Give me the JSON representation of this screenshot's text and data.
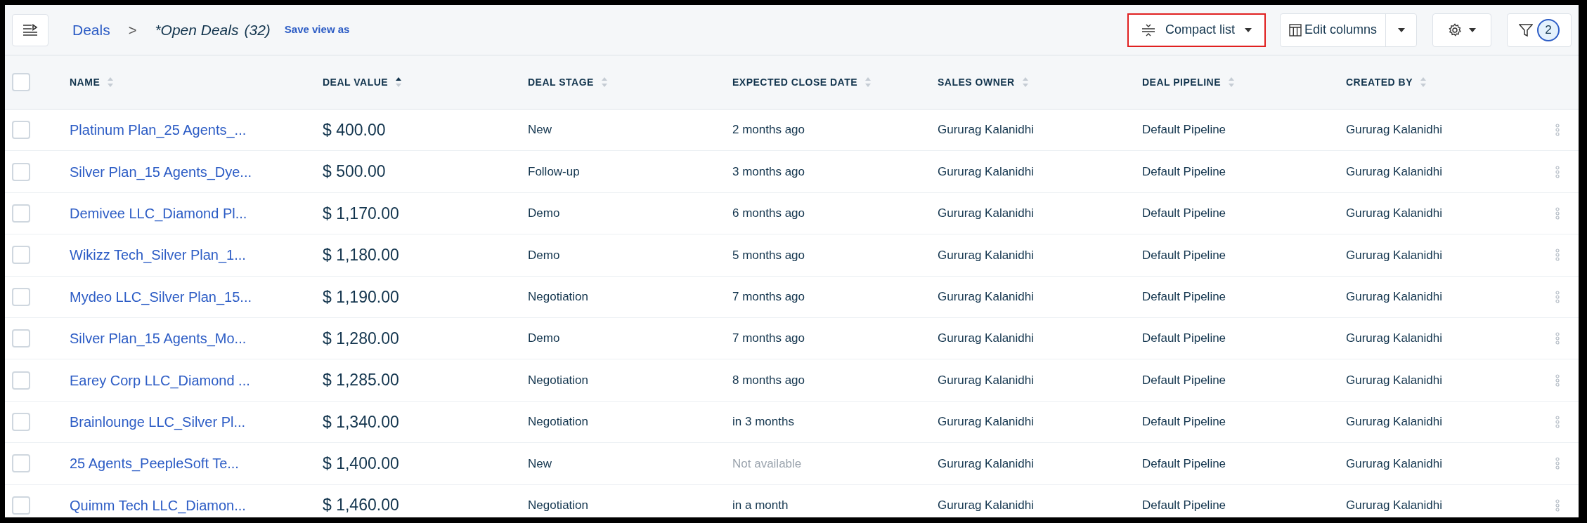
{
  "toolbar": {
    "breadcrumb": {
      "root": "Deals",
      "separator": ">",
      "current": "*Open Deals",
      "count": "(32)"
    },
    "save_view_link": "Save view as",
    "view_button": {
      "label": "Compact list",
      "highlighted": true
    },
    "edit_columns_button": "Edit columns",
    "filter_count": "2"
  },
  "table": {
    "columns": [
      {
        "label": "NAME",
        "sorted_ascending": false
      },
      {
        "label": "DEAL VALUE",
        "sorted_ascending": true
      },
      {
        "label": "DEAL STAGE",
        "sorted_ascending": false
      },
      {
        "label": "EXPECTED CLOSE DATE",
        "sorted_ascending": false
      },
      {
        "label": "SALES OWNER",
        "sorted_ascending": false
      },
      {
        "label": "DEAL PIPELINE",
        "sorted_ascending": false
      },
      {
        "label": "CREATED BY",
        "sorted_ascending": false
      }
    ],
    "select_all_checked": false,
    "rows": [
      {
        "checked": false,
        "name": "Platinum Plan_25 Agents_...",
        "value": "$ 400.00",
        "stage": "New",
        "close_date": "2 months ago",
        "close_date_muted": false,
        "owner": "Gururag Kalanidhi",
        "pipeline": "Default Pipeline",
        "created_by": "Gururag Kalanidhi"
      },
      {
        "checked": false,
        "name": "Silver Plan_15 Agents_Dye...",
        "value": "$ 500.00",
        "stage": "Follow-up",
        "close_date": "3 months ago",
        "close_date_muted": false,
        "owner": "Gururag Kalanidhi",
        "pipeline": "Default Pipeline",
        "created_by": "Gururag Kalanidhi"
      },
      {
        "checked": false,
        "name": "Demivee LLC_Diamond Pl...",
        "value": "$ 1,170.00",
        "stage": "Demo",
        "close_date": "6 months ago",
        "close_date_muted": false,
        "owner": "Gururag Kalanidhi",
        "pipeline": "Default Pipeline",
        "created_by": "Gururag Kalanidhi"
      },
      {
        "checked": false,
        "name": "Wikizz Tech_Silver Plan_1...",
        "value": "$ 1,180.00",
        "stage": "Demo",
        "close_date": "5 months ago",
        "close_date_muted": false,
        "owner": "Gururag Kalanidhi",
        "pipeline": "Default Pipeline",
        "created_by": "Gururag Kalanidhi"
      },
      {
        "checked": false,
        "name": "Mydeo LLC_Silver Plan_15...",
        "value": "$ 1,190.00",
        "stage": "Negotiation",
        "close_date": "7 months ago",
        "close_date_muted": false,
        "owner": "Gururag Kalanidhi",
        "pipeline": "Default Pipeline",
        "created_by": "Gururag Kalanidhi"
      },
      {
        "checked": false,
        "name": "Silver Plan_15 Agents_Mo...",
        "value": "$ 1,280.00",
        "stage": "Demo",
        "close_date": "7 months ago",
        "close_date_muted": false,
        "owner": "Gururag Kalanidhi",
        "pipeline": "Default Pipeline",
        "created_by": "Gururag Kalanidhi"
      },
      {
        "checked": false,
        "name": "Earey Corp LLC_Diamond ...",
        "value": "$ 1,285.00",
        "stage": "Negotiation",
        "close_date": "8 months ago",
        "close_date_muted": false,
        "owner": "Gururag Kalanidhi",
        "pipeline": "Default Pipeline",
        "created_by": "Gururag Kalanidhi"
      },
      {
        "checked": false,
        "name": "Brainlounge LLC_Silver Pl...",
        "value": "$ 1,340.00",
        "stage": "Negotiation",
        "close_date": "in 3 months",
        "close_date_muted": false,
        "owner": "Gururag Kalanidhi",
        "pipeline": "Default Pipeline",
        "created_by": "Gururag Kalanidhi"
      },
      {
        "checked": false,
        "name": "25 Agents_PeepleSoft Te...",
        "value": "$ 1,400.00",
        "stage": "New",
        "close_date": "Not available",
        "close_date_muted": true,
        "owner": "Gururag Kalanidhi",
        "pipeline": "Default Pipeline",
        "created_by": "Gururag Kalanidhi"
      },
      {
        "checked": false,
        "name": "Quimm Tech LLC_Diamon...",
        "value": "$ 1,460.00",
        "stage": "Negotiation",
        "close_date": "in a month",
        "close_date_muted": false,
        "owner": "Gururag Kalanidhi",
        "pipeline": "Default Pipeline",
        "created_by": "Gururag Kalanidhi"
      }
    ]
  }
}
